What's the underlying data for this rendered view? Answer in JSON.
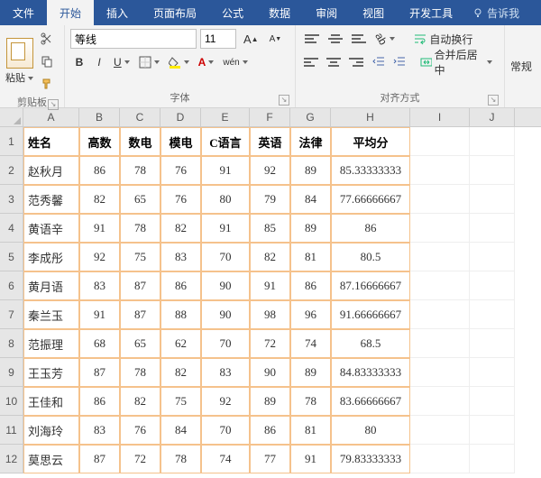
{
  "tabs": {
    "file": "文件",
    "home": "开始",
    "insert": "插入",
    "layout": "页面布局",
    "formula": "公式",
    "data": "数据",
    "review": "审阅",
    "view": "视图",
    "dev": "开发工具",
    "tell": "告诉我"
  },
  "ribbon": {
    "clipboard": {
      "paste": "粘贴",
      "label": "剪贴板"
    },
    "font": {
      "family": "等线",
      "size": "11",
      "bold": "B",
      "italic": "I",
      "underline": "U",
      "wen": "wén",
      "A_big": "A",
      "A_small": "A",
      "label": "字体"
    },
    "align": {
      "wrap": "自动换行",
      "merge": "合并后居中",
      "label": "对齐方式"
    },
    "normal": "常规"
  },
  "columns": [
    "A",
    "B",
    "C",
    "D",
    "E",
    "F",
    "G",
    "H",
    "I",
    "J"
  ],
  "header_row": [
    "姓名",
    "高数",
    "数电",
    "模电",
    "C语言",
    "英语",
    "法律",
    "平均分",
    "",
    ""
  ],
  "rows": [
    [
      "赵秋月",
      "86",
      "78",
      "76",
      "91",
      "92",
      "89",
      "85.33333333",
      "",
      ""
    ],
    [
      "范秀馨",
      "82",
      "65",
      "76",
      "80",
      "79",
      "84",
      "77.66666667",
      "",
      ""
    ],
    [
      "黄语辛",
      "91",
      "78",
      "82",
      "91",
      "85",
      "89",
      "86",
      "",
      ""
    ],
    [
      "李成彤",
      "92",
      "75",
      "83",
      "70",
      "82",
      "81",
      "80.5",
      "",
      ""
    ],
    [
      "黄月语",
      "83",
      "87",
      "86",
      "90",
      "91",
      "86",
      "87.16666667",
      "",
      ""
    ],
    [
      "秦兰玉",
      "91",
      "87",
      "88",
      "90",
      "98",
      "96",
      "91.66666667",
      "",
      ""
    ],
    [
      "范振理",
      "68",
      "65",
      "62",
      "70",
      "72",
      "74",
      "68.5",
      "",
      ""
    ],
    [
      "王玉芳",
      "87",
      "78",
      "82",
      "83",
      "90",
      "89",
      "84.83333333",
      "",
      ""
    ],
    [
      "王佳和",
      "86",
      "82",
      "75",
      "92",
      "89",
      "78",
      "83.66666667",
      "",
      ""
    ],
    [
      "刘海玲",
      "83",
      "76",
      "84",
      "70",
      "86",
      "81",
      "80",
      "",
      ""
    ],
    [
      "莫思云",
      "87",
      "72",
      "78",
      "74",
      "77",
      "91",
      "79.83333333",
      "",
      ""
    ]
  ]
}
